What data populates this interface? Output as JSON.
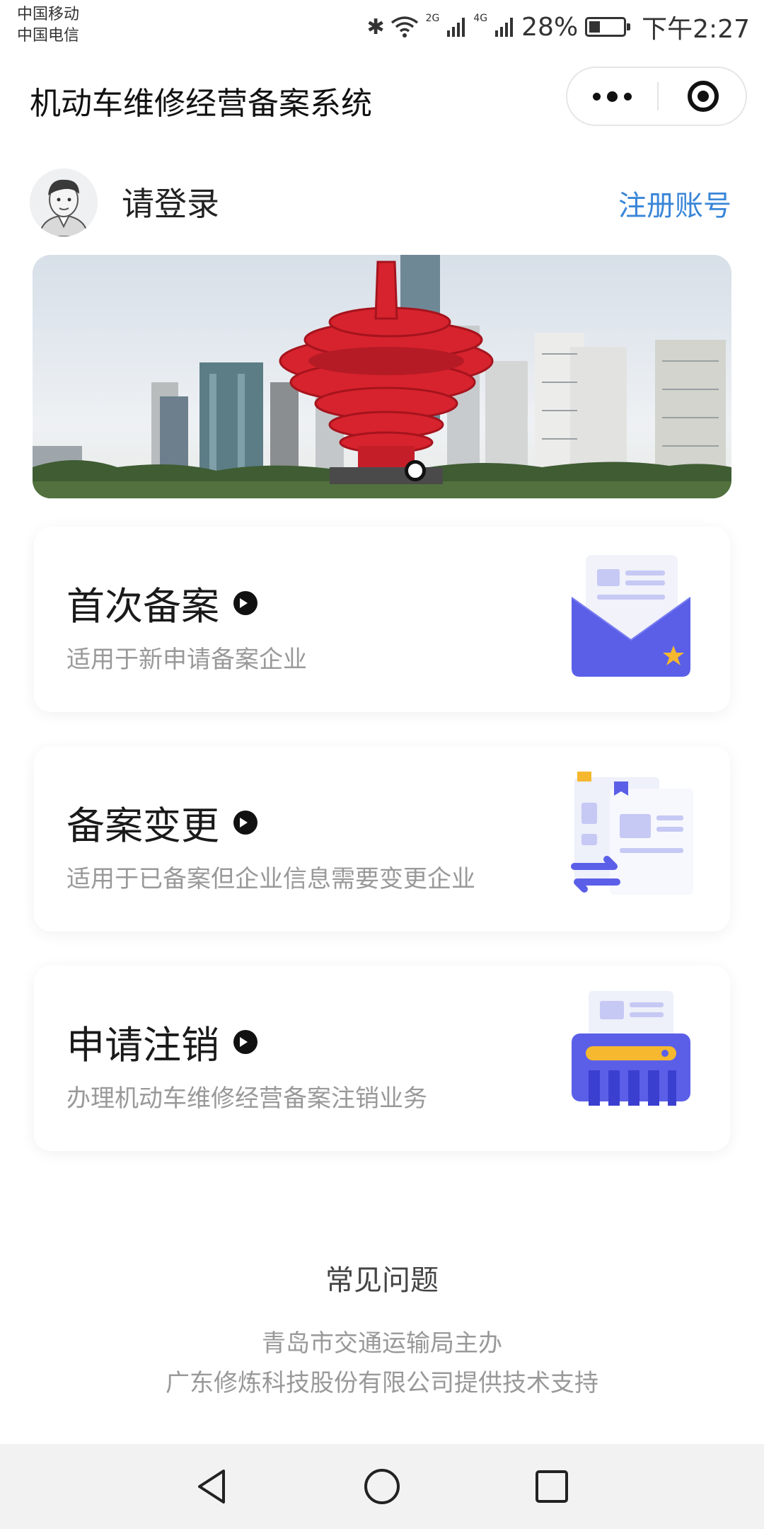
{
  "status_bar": {
    "carrier_1": "中国移动",
    "carrier_2": "中国电信",
    "network_1": "2G",
    "network_2": "4G",
    "battery": "28%",
    "time": "下午2:27"
  },
  "app": {
    "title": "机动车维修经营备案系统"
  },
  "user": {
    "login_prompt": "请登录",
    "register_label": "注册账号"
  },
  "banner": {
    "slide_count": 1,
    "active_index": 0
  },
  "services": [
    {
      "title": "首次备案",
      "description": "适用于新申请备案企业",
      "icon": "envelope-document-icon"
    },
    {
      "title": "备案变更",
      "description": "适用于已备案但企业信息需要变更企业",
      "icon": "document-swap-icon"
    },
    {
      "title": "申请注销",
      "description": "办理机动车维修经营备案注销业务",
      "icon": "shredder-icon"
    }
  ],
  "footer": {
    "faq_label": "常见问题",
    "sponsor": "青岛市交通运输局主办",
    "support": "广东修炼科技股份有限公司提供技术支持"
  },
  "colors": {
    "accent_blue": "#3a86d8",
    "illustration_purple": "#5b5fe8",
    "illustration_gold": "#f5b82e"
  }
}
